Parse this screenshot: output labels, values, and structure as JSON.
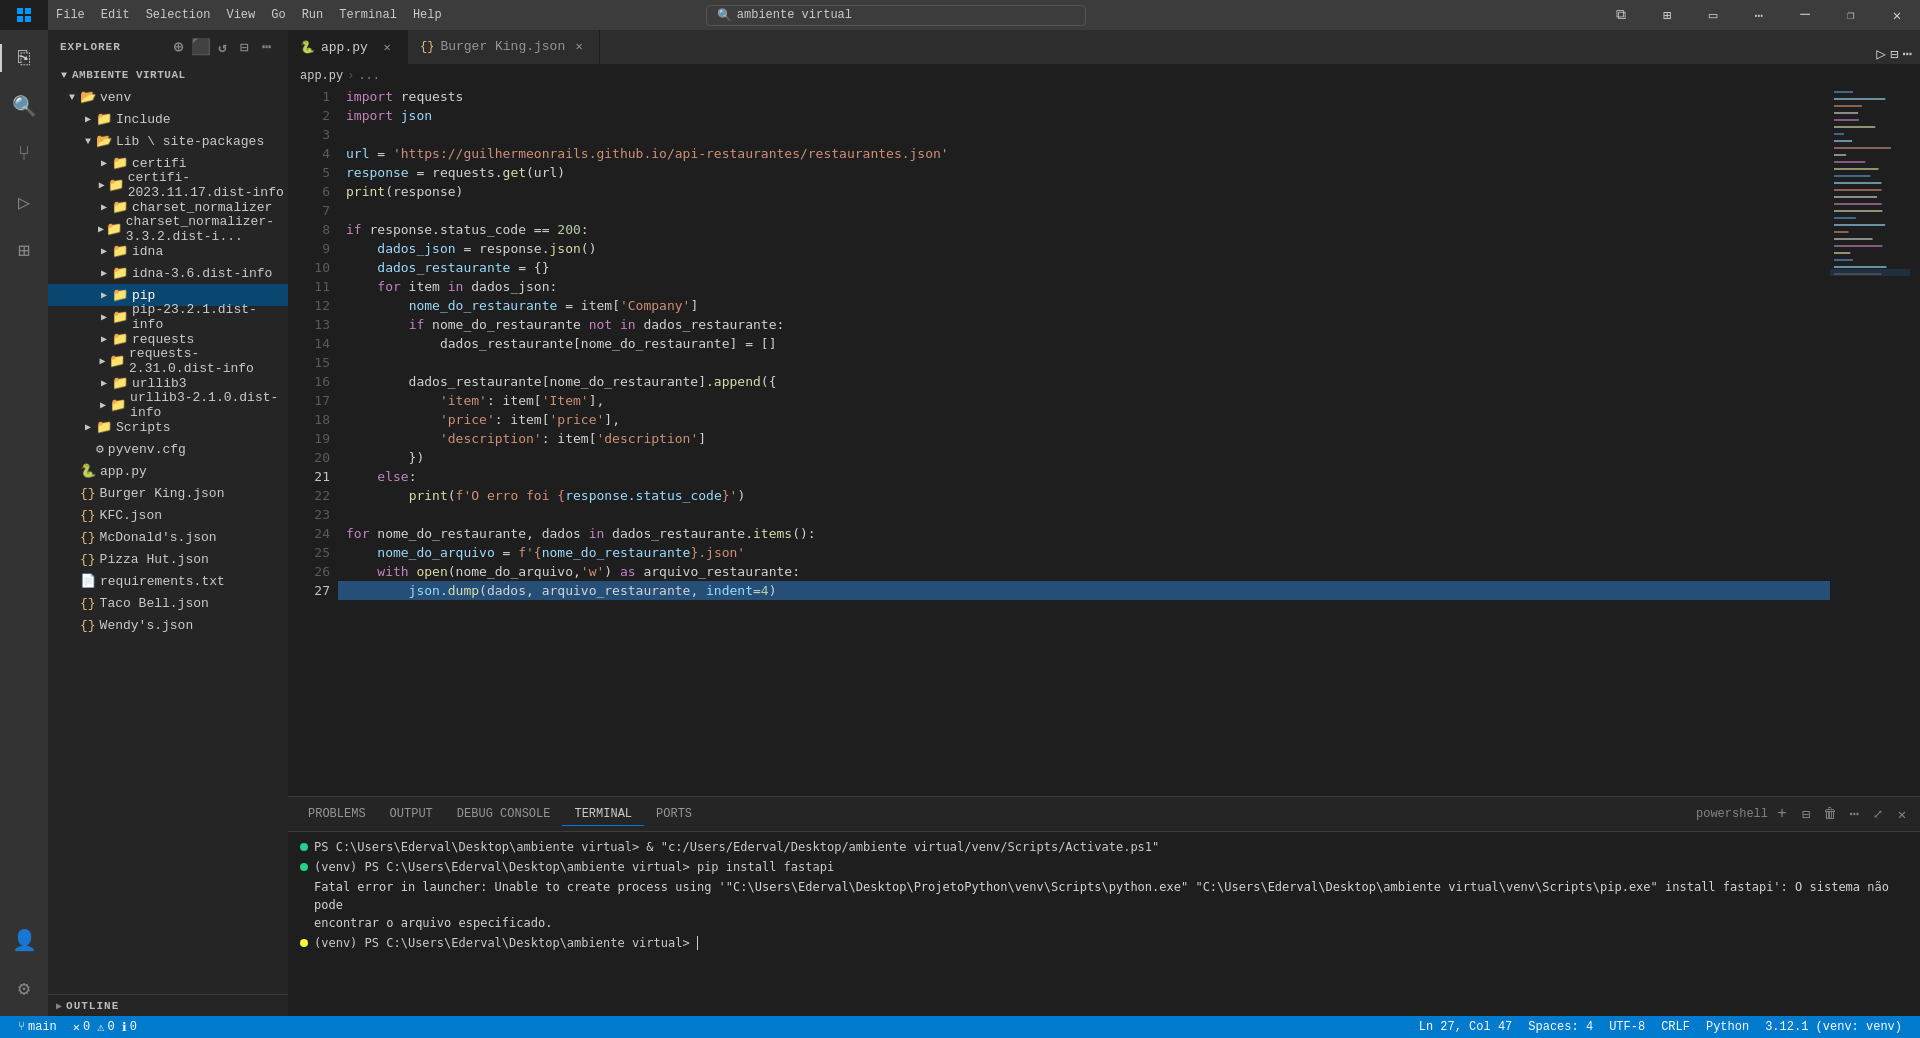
{
  "titlebar": {
    "icon": "⊞",
    "menus": [
      "File",
      "Edit",
      "Selection",
      "View",
      "Go",
      "Run",
      "Terminal",
      "Help"
    ],
    "search_placeholder": "ambiente virtual",
    "window_controls": [
      "⬜",
      "❐",
      "✕"
    ]
  },
  "activity_bar": {
    "items": [
      {
        "icon": "⎘",
        "label": "explorer-icon",
        "active": true
      },
      {
        "icon": "🔍",
        "label": "search-icon"
      },
      {
        "icon": "⑂",
        "label": "source-control-icon"
      },
      {
        "icon": "▷",
        "label": "run-debug-icon"
      },
      {
        "icon": "⊞",
        "label": "extensions-icon"
      }
    ],
    "bottom_items": [
      {
        "icon": "👤",
        "label": "account-icon"
      },
      {
        "icon": "⚙",
        "label": "settings-icon"
      }
    ]
  },
  "sidebar": {
    "title": "Explorer",
    "header_icons": [
      "⊕",
      "⊕",
      "↺",
      "⊟"
    ],
    "tree": [
      {
        "label": "AMBIENTE VIRTUAL",
        "level": 0,
        "type": "root",
        "expanded": true
      },
      {
        "label": "venv",
        "level": 1,
        "type": "folder",
        "expanded": true
      },
      {
        "label": "Include",
        "level": 2,
        "type": "folder",
        "expanded": false
      },
      {
        "label": "Lib \\ site-packages",
        "level": 2,
        "type": "folder",
        "expanded": true
      },
      {
        "label": "certifi",
        "level": 3,
        "type": "folder"
      },
      {
        "label": "certifi-2023.11.17.dist-info",
        "level": 3,
        "type": "folder"
      },
      {
        "label": "charset_normalizer",
        "level": 3,
        "type": "folder"
      },
      {
        "label": "charset_normalizer-3.3.2.dist-i...",
        "level": 3,
        "type": "folder"
      },
      {
        "label": "idna",
        "level": 3,
        "type": "folder"
      },
      {
        "label": "idna-3.6.dist-info",
        "level": 3,
        "type": "folder"
      },
      {
        "label": "pip",
        "level": 3,
        "type": "folder",
        "selected": true
      },
      {
        "label": "pip-23.2.1.dist-info",
        "level": 3,
        "type": "folder"
      },
      {
        "label": "requests",
        "level": 3,
        "type": "folder"
      },
      {
        "label": "requests-2.31.0.dist-info",
        "level": 3,
        "type": "folder"
      },
      {
        "label": "urllib3",
        "level": 3,
        "type": "folder"
      },
      {
        "label": "urllib3-2.1.0.dist-info",
        "level": 3,
        "type": "folder"
      },
      {
        "label": "Scripts",
        "level": 2,
        "type": "folder"
      },
      {
        "label": "pyvenv.cfg",
        "level": 2,
        "type": "file-cfg"
      },
      {
        "label": "app.py",
        "level": 1,
        "type": "file-py"
      },
      {
        "label": "Burger King.json",
        "level": 1,
        "type": "file-json"
      },
      {
        "label": "KFC.json",
        "level": 1,
        "type": "file-json"
      },
      {
        "label": "McDonald's.json",
        "level": 1,
        "type": "file-json"
      },
      {
        "label": "Pizza Hut.json",
        "level": 1,
        "type": "file-json"
      },
      {
        "label": "requirements.txt",
        "level": 1,
        "type": "file-txt"
      },
      {
        "label": "Taco Bell.json",
        "level": 1,
        "type": "file-json"
      },
      {
        "label": "Wendy's.json",
        "level": 1,
        "type": "file-json"
      }
    ],
    "outline": "OUTLINE"
  },
  "tabs": [
    {
      "label": "app.py",
      "active": true,
      "icon": "py",
      "modified": false
    },
    {
      "label": "Burger King.json",
      "active": false,
      "icon": "json",
      "modified": false
    }
  ],
  "breadcrumb": [
    "app.py",
    "›",
    "..."
  ],
  "editor": {
    "lines": [
      {
        "num": 1,
        "content": "import requests",
        "tokens": [
          {
            "t": "kw",
            "v": "import"
          },
          {
            "t": "plain",
            "v": " requests"
          }
        ]
      },
      {
        "num": 2,
        "content": "import json",
        "tokens": [
          {
            "t": "kw",
            "v": "import"
          },
          {
            "t": "plain",
            "v": " "
          },
          {
            "t": "var",
            "v": "json"
          }
        ]
      },
      {
        "num": 3,
        "content": ""
      },
      {
        "num": 4,
        "content": "url = 'https://guilhermeonrails.github.io/api-restaurantes/restaurantes.json'"
      },
      {
        "num": 5,
        "content": "response = requests.get(url)"
      },
      {
        "num": 6,
        "content": "print(response)"
      },
      {
        "num": 7,
        "content": ""
      },
      {
        "num": 8,
        "content": "if response.status_code == 200:"
      },
      {
        "num": 9,
        "content": "    dados_json = response.json()"
      },
      {
        "num": 10,
        "content": "    dados_restaurante = {}"
      },
      {
        "num": 11,
        "content": "    for item in dados_json:"
      },
      {
        "num": 12,
        "content": "        nome_do_restaurante = item['Company']"
      },
      {
        "num": 13,
        "content": "        if nome_do_restaurante not in dados_restaurante:"
      },
      {
        "num": 14,
        "content": "            dados_restaurante[nome_do_restaurante] = []"
      },
      {
        "num": 15,
        "content": ""
      },
      {
        "num": 16,
        "content": "        dados_restaurante[nome_do_restaurante].append({"
      },
      {
        "num": 17,
        "content": "            'item': item['Item'],"
      },
      {
        "num": 18,
        "content": "            'price': item['price'],"
      },
      {
        "num": 19,
        "content": "            'description': item['description']"
      },
      {
        "num": 20,
        "content": "        })"
      },
      {
        "num": 21,
        "content": "    else:"
      },
      {
        "num": 22,
        "content": "        print(f'O erro foi {response.status_code}')"
      },
      {
        "num": 23,
        "content": ""
      },
      {
        "num": 24,
        "content": "for nome_do_restaurante, dados in dados_restaurante.items():"
      },
      {
        "num": 25,
        "content": "    nome_do_arquivo = f'{nome_do_restaurante}.json'"
      },
      {
        "num": 26,
        "content": "    with open(nome_do_arquivo,'w') as arquivo_restaurante:"
      },
      {
        "num": 27,
        "content": "        json.dump(dados, arquivo_restaurante, indent=4)",
        "highlighted": true
      }
    ]
  },
  "terminal": {
    "tabs": [
      "PROBLEMS",
      "OUTPUT",
      "DEBUG CONSOLE",
      "TERMINAL",
      "PORTS"
    ],
    "active_tab": "TERMINAL",
    "shell_label": "powershell",
    "lines": [
      {
        "type": "success",
        "text": "PS C:\\Users\\Ederval\\Desktop\\ambiente virtual> & \"c:/Users/Ederval/Desktop/ambiente virtual/venv/Scripts/Activate.ps1\""
      },
      {
        "type": "success",
        "text": "(venv) PS C:\\Users\\Ederval\\Desktop\\ambiente virtual> pip install fastapi"
      },
      {
        "type": "error",
        "text": "Fatal error in launcher: Unable to create process using '\"C:\\Users\\Ederval\\Desktop\\ProjetoPython\\venv\\Scripts\\python.exe\"  \"C:\\Users\\Ederval\\Desktop\\ambiente virtual\\venv\\Scripts\\pip.exe\" install fastapi': O sistema não pode\nencontrar o arquivo especificado."
      },
      {
        "type": "prompt",
        "text": "(venv) PS C:\\Users\\Ederval\\Desktop\\ambiente virtual> "
      }
    ]
  },
  "status_bar": {
    "errors": "0",
    "warnings": "0",
    "info": "0",
    "position": "Ln 27, Col 47",
    "spaces": "Spaces: 4",
    "encoding": "UTF-8",
    "line_endings": "CRLF",
    "language": "Python",
    "version": "3.12.1 (venv: venv)"
  }
}
